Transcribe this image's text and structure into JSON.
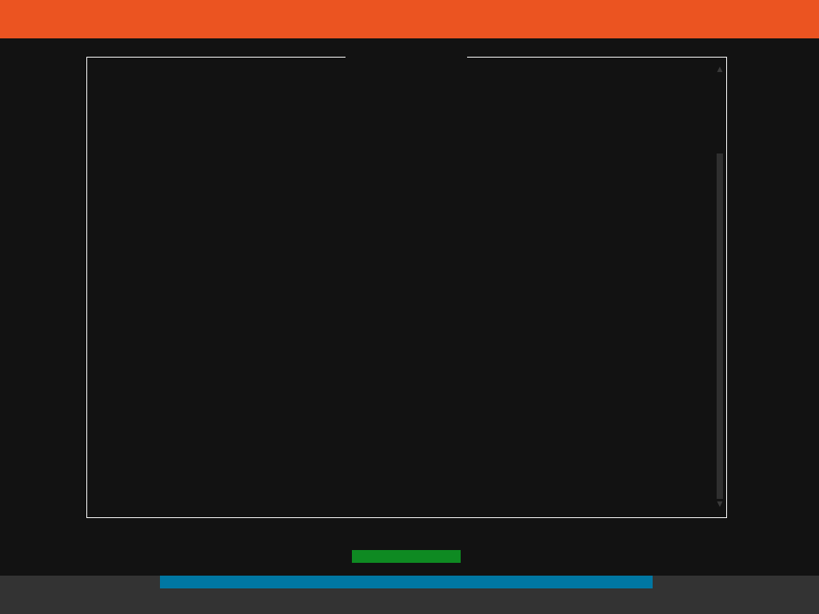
{
  "colors": {
    "header": "#EB5421",
    "background": "#121212",
    "frame_border": "#FFFFFF",
    "scrollbar": "#2F2F2F",
    "progress": "#0E8A22",
    "footer": "#333333",
    "input_strip": "#0077A3"
  },
  "frame": {
    "title": "",
    "content": ""
  },
  "scrollbar": {
    "up_glyph": "▲",
    "down_glyph": "▼"
  }
}
